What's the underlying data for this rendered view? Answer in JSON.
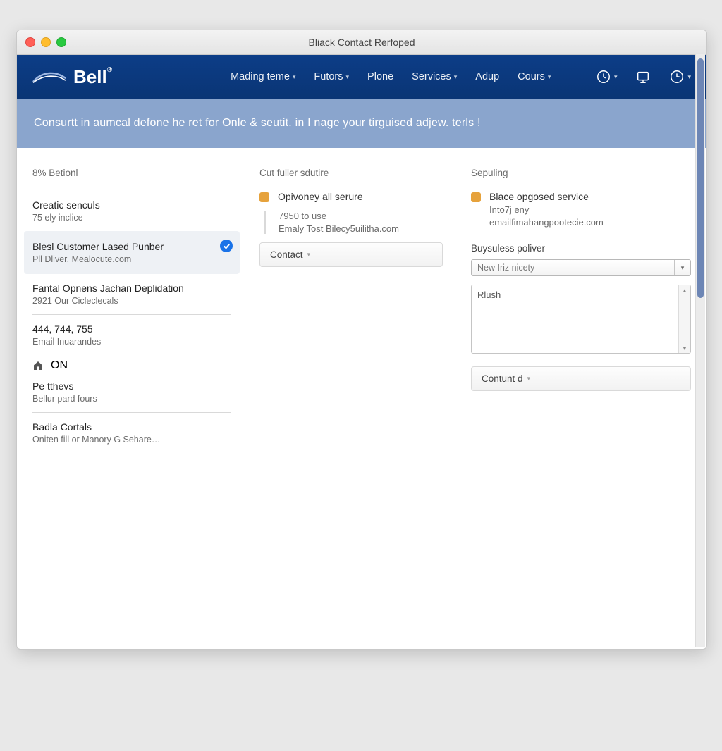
{
  "window": {
    "title": "Bliack Contact Rerfoped"
  },
  "brand": {
    "name": "Bell"
  },
  "nav": {
    "items": [
      {
        "label": "Mading teme",
        "has_caret": true
      },
      {
        "label": "Futors",
        "has_caret": true
      },
      {
        "label": "Plone",
        "has_caret": false
      },
      {
        "label": "Services",
        "has_caret": true
      },
      {
        "label": "Adup",
        "has_caret": false
      },
      {
        "label": "Cours",
        "has_caret": true
      }
    ]
  },
  "banner": {
    "text": "Consurtt in aumcal defone he ret for Onle & seutit. in I nage your tirguised adjew. terls !"
  },
  "left": {
    "heading": "8% Betionl",
    "items": [
      {
        "title": "Creatic senculs",
        "subtitle": "75 ely inclice",
        "selected": false
      },
      {
        "title": "Blesl Customer Lased Punber",
        "subtitle": "Pll Dliver, Mealocute.com",
        "selected": true
      },
      {
        "title": "Fantal Opnens Jachan Deplidation",
        "subtitle": "2921 Our Cicleclecals",
        "selected": false
      },
      {
        "title": "444, 744, 755",
        "subtitle": "Email Inuarandes",
        "selected": false
      }
    ],
    "home": {
      "label": "ON"
    },
    "patthevs": {
      "title": "Pe tthevs",
      "subtitle": "Bellur pard fours"
    },
    "bada": {
      "title": "Badla Cortals",
      "subtitle": "Oniten fill or Manory G Sehare…"
    }
  },
  "mid": {
    "heading": "Cut fuller sdutire",
    "card": {
      "title": "Opivoney all serure",
      "line1": "7950 to use",
      "line2": "Emaly Tost Bilecy5uilitha.com"
    },
    "button": "Contact"
  },
  "right": {
    "heading": "Sepuling",
    "card": {
      "title": "Blace opgosed service",
      "line1": "Into7j eny",
      "line2": "emailfimahangpootecie.com"
    },
    "sub": "Buysuless poliver",
    "dropdown_placeholder": "New Iriz nicety",
    "list_value": "Rlush",
    "button": "Contunt d"
  }
}
